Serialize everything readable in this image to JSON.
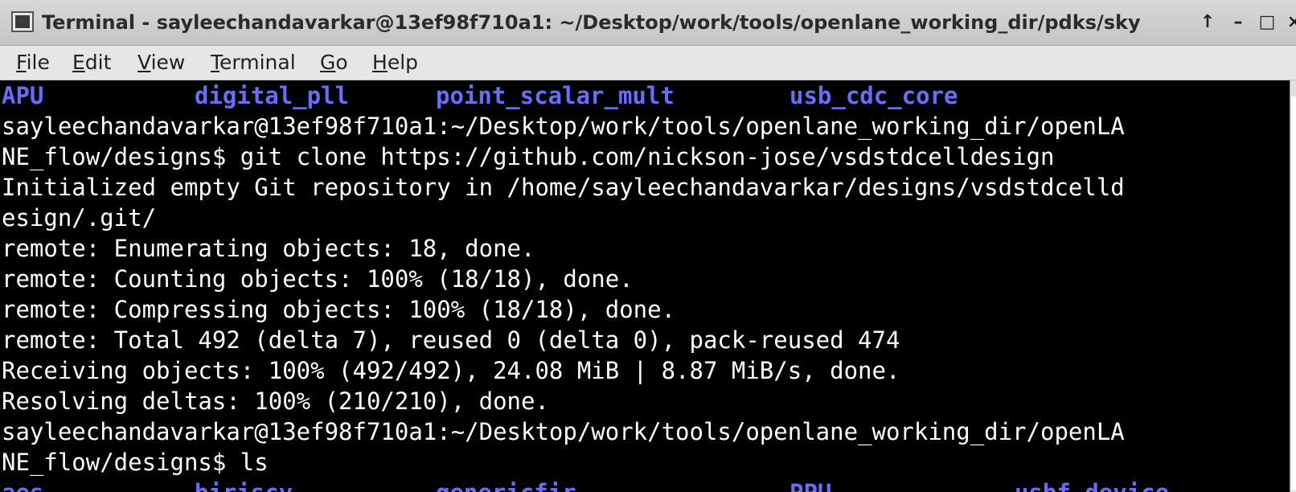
{
  "window": {
    "title": "Terminal - sayleechandavarkar@13ef98f710a1: ~/Desktop/work/tools/openlane_working_dir/pdks/sky",
    "controls": {
      "up": "↑",
      "minimize": "–",
      "maximize": "□",
      "close": "×"
    }
  },
  "menu": {
    "items": [
      "File",
      "Edit",
      "View",
      "Terminal",
      "Go",
      "Help"
    ]
  },
  "terminal": {
    "dir_listing_top": [
      "APU",
      "digital_pll",
      "point_scalar_mult",
      "usb_cdc_core"
    ],
    "lines": [
      "sayleechandavarkar@13ef98f710a1:~/Desktop/work/tools/openlane_working_dir/openLA",
      "NE_flow/designs$ git clone https://github.com/nickson-jose/vsdstdcelldesign",
      "Initialized empty Git repository in /home/sayleechandavarkar/designs/vsdstdcelld",
      "esign/.git/",
      "remote: Enumerating objects: 18, done.",
      "remote: Counting objects: 100% (18/18), done.",
      "remote: Compressing objects: 100% (18/18), done.",
      "remote: Total 492 (delta 7), reused 0 (delta 0), pack-reused 474",
      "Receiving objects: 100% (492/492), 24.08 MiB | 8.87 MiB/s, done.",
      "Resolving deltas: 100% (210/210), done.",
      "sayleechandavarkar@13ef98f710a1:~/Desktop/work/tools/openlane_working_dir/openLA",
      "NE_flow/designs$ ls"
    ],
    "dir_listing_bottom": [
      "aes",
      "biriscv",
      "genericfir",
      "PPU",
      "usbf_device"
    ]
  }
}
